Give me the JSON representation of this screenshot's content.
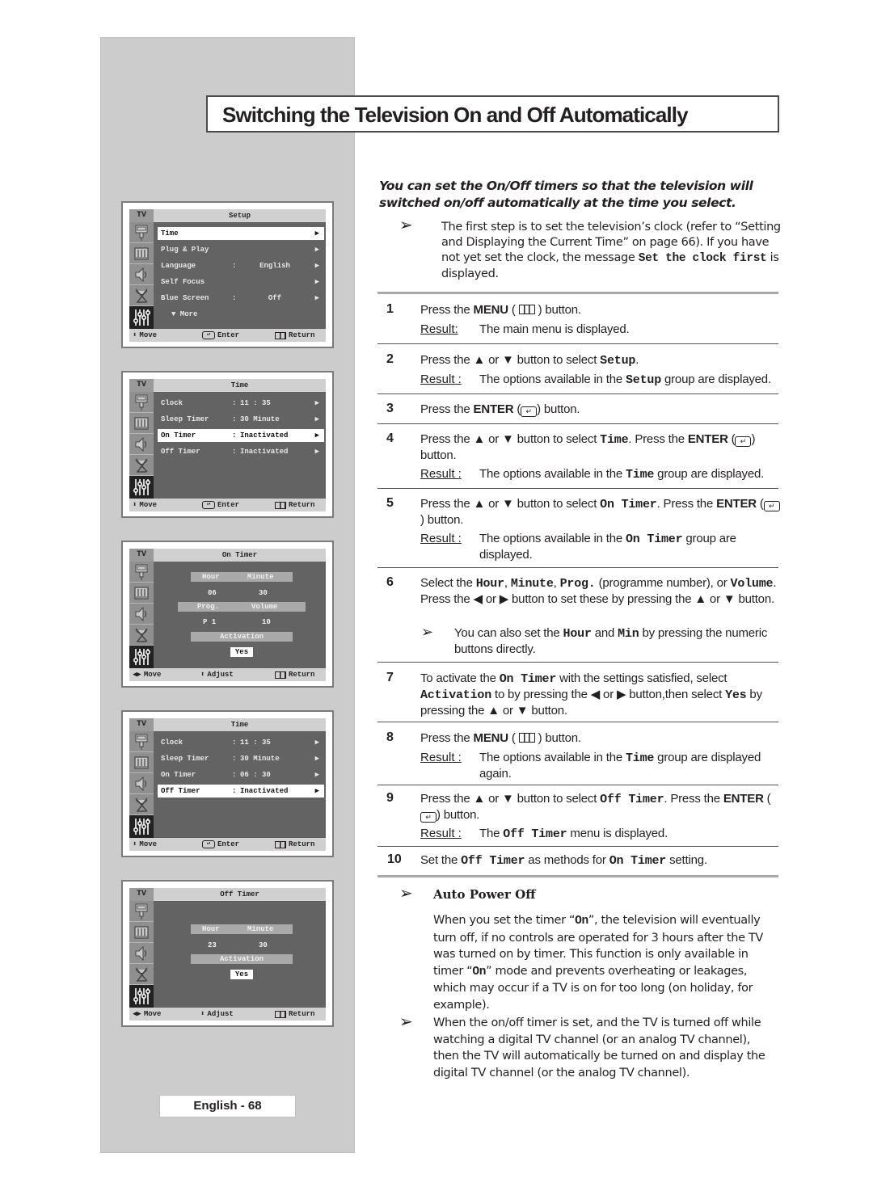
{
  "page": {
    "title": "Switching the Television On and Off Automatically",
    "page_number": "English - 68"
  },
  "intro": {
    "text": "You can set the On/Off timers so that the television will switched on/off automatically at the time you select.",
    "note_part1": "The first step is to set the television’s clock (refer to “Setting and Displaying the Current Time” on page 66). If you have not yet set the clock,  the message ",
    "note_code": "Set the clock first",
    "note_part2": " is displayed."
  },
  "steps": [
    {
      "num": "1",
      "text_pre": "Press the ",
      "bold": "MENU",
      "text_post": " button.",
      "icon": "menu-icon",
      "result_label": "Result:",
      "result": "The main menu is displayed."
    },
    {
      "num": "2",
      "text_pre": "Press the ▲ or ▼ button to select ",
      "code": "Setup",
      "text_post": ".",
      "result_label": "Result :",
      "result_pre": "The options available in the ",
      "result_code": "Setup",
      "result_post": " group are displayed."
    },
    {
      "num": "3",
      "text_pre": "Press the ",
      "bold": "ENTER",
      "text_post": " button.",
      "icon": "enter-icon"
    },
    {
      "num": "4",
      "text_pre": "Press the ▲ or ▼ button to select ",
      "code": "Time",
      "text_mid": ". Press the ",
      "bold": "ENTER",
      "text_post": " button.",
      "result_label": "Result :",
      "result_pre": "The options available in the ",
      "result_code": "Time",
      "result_post": " group are displayed."
    },
    {
      "num": "5",
      "text_pre": "Press the ▲ or ▼ button to select ",
      "code": "On Timer",
      "text_mid": ". Press the ",
      "bold": "ENTER",
      "text_post": " button.",
      "result_label": "Result :",
      "result_pre": "The options available in the ",
      "result_code": "On Timer",
      "result_post": " group are displayed."
    },
    {
      "num": "6",
      "text_pre": "Select the ",
      "code1": "Hour",
      "sep1": ", ",
      "code2": "Minute",
      "sep2": ", ",
      "code3": "Prog.",
      "text_mid": " (programme number), or ",
      "code4": "Volume",
      "text_post": ". Press the ◀ or ▶ button to set these by pressing the ▲ or ▼ button.",
      "note_pre": "You can also set the ",
      "note_code1": "Hour",
      "note_mid": " and ",
      "note_code2": "Min",
      "note_post": " by pressing the numeric buttons directly."
    },
    {
      "num": "7",
      "text_pre": "To activate the ",
      "code1": "On Timer",
      "text_mid1": " with the settings satisfied, select ",
      "code2": "Activation",
      "text_mid2": " to by pressing the ◀ or ▶ button,then select ",
      "code3": "Yes",
      "text_post": " by pressing the ▲ or ▼ button."
    },
    {
      "num": "8",
      "text_pre": "Press the ",
      "bold": "MENU",
      "text_post": " button.",
      "result_label": "Result :",
      "result_pre": "The options available in the ",
      "result_code": "Time",
      "result_post": " group are displayed again."
    },
    {
      "num": "9",
      "text_pre": "Press the ▲ or ▼ button to select ",
      "code": "Off Timer",
      "text_mid": ". Press the ",
      "bold": "ENTER",
      "text_post": " button.",
      "result_label": "Result :",
      "result_pre": "The ",
      "result_code": "Off Timer",
      "result_post": " menu is displayed."
    },
    {
      "num": "10",
      "text_pre": "Set the ",
      "code1": "Off Timer",
      "text_mid": " as methods for ",
      "code2": "On Timer",
      "text_post": " setting."
    }
  ],
  "auto_power_off": {
    "heading": "Auto Power Off",
    "p1_pre": "When you set the timer “",
    "p1_code": "On",
    "p1_mid": "”, the television will eventually turn off, if no controls are operated for 3 hours after the TV was turned on by timer. This function is only available in timer “",
    "p1_code2": "On",
    "p1_post": "” mode and prevents overheating or leakages, which may occur if a TV is on for too long (on holiday, for example).",
    "note2": "When the on/off timer is set, and the TV is turned off while watching a digital TV channel (or an analog TV channel), then the TV will automatically be turned on and display the digital TV channel (or the analog TV channel)."
  },
  "screens": [
    {
      "tv_label": "TV",
      "title": "Setup",
      "rows": [
        {
          "label": "Time",
          "colon": "",
          "value": "",
          "selected": true
        },
        {
          "label": "Plug & Play",
          "colon": "",
          "value": ""
        },
        {
          "label": "Language",
          "colon": ":",
          "value": "English"
        },
        {
          "label": "Self Focus",
          "colon": "",
          "value": ""
        },
        {
          "label": "Blue Screen",
          "colon": ":",
          "value": "Off"
        }
      ],
      "more": "▼ More",
      "footer": {
        "left": "Move",
        "mid": "Enter",
        "right": "Return"
      }
    },
    {
      "tv_label": "TV",
      "title": "Time",
      "rows": [
        {
          "label": "Clock",
          "colon": ":",
          "value": "11 : 35"
        },
        {
          "label": "Sleep Timer",
          "colon": ":",
          "value": "30 Minute"
        },
        {
          "label": "On Timer",
          "colon": ":",
          "value": "Inactivated",
          "selected": true
        },
        {
          "label": "Off Timer",
          "colon": ":",
          "value": "Inactivated"
        }
      ],
      "footer": {
        "left": "Move",
        "mid": "Enter",
        "right": "Return"
      }
    },
    {
      "tv_label": "TV",
      "title": "On Timer",
      "hour_label": "Hour",
      "minute_label": "Minute",
      "hour": "06",
      "minute": "30",
      "prog_label": "Prog.",
      "volume_label": "Volume",
      "prog": "P 1",
      "volume": "10",
      "activation_label": "Activation",
      "activation": "Yes",
      "footer": {
        "left": "Move",
        "mid": "Adjust",
        "right": "Return"
      }
    },
    {
      "tv_label": "TV",
      "title": "Time",
      "rows": [
        {
          "label": "Clock",
          "colon": ":",
          "value": "11 : 35"
        },
        {
          "label": "Sleep Timer",
          "colon": ":",
          "value": "30 Minute"
        },
        {
          "label": "On Timer",
          "colon": ":",
          "value": "06 : 30"
        },
        {
          "label": "Off Timer",
          "colon": ":",
          "value": "Inactivated",
          "selected": true
        }
      ],
      "footer": {
        "left": "Move",
        "mid": "Enter",
        "right": "Return"
      }
    },
    {
      "tv_label": "TV",
      "title": "Off Timer",
      "hour_label": "Hour",
      "minute_label": "Minute",
      "hour": "23",
      "minute": "30",
      "activation_label": "Activation",
      "activation": "Yes",
      "footer": {
        "left": "Move",
        "mid": "Adjust",
        "right": "Return"
      }
    }
  ]
}
